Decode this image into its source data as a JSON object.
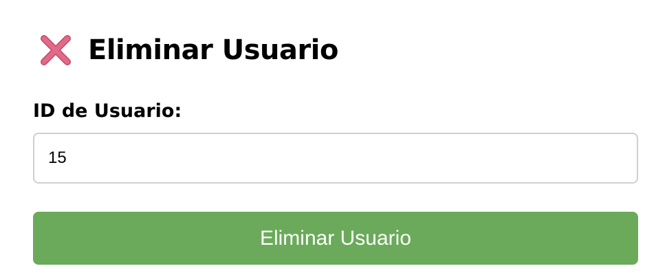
{
  "header": {
    "icon": "cross-mark-icon",
    "title": "Eliminar Usuario"
  },
  "form": {
    "user_id_label": "ID de Usuario:",
    "user_id_value": "15",
    "submit_label": "Eliminar Usuario"
  },
  "colors": {
    "icon": "#e06a88",
    "button": "#6aaa5a",
    "button_text": "#ffffff",
    "input_border": "#cfcfcf"
  }
}
